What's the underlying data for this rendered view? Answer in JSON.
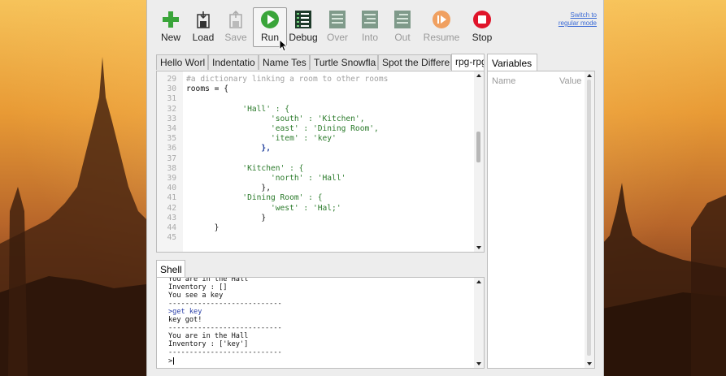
{
  "toolbar": {
    "buttons": [
      {
        "id": "new",
        "label": "New",
        "icon": "plus-icon",
        "enabled": true
      },
      {
        "id": "load",
        "label": "Load",
        "icon": "load-icon",
        "enabled": true
      },
      {
        "id": "save",
        "label": "Save",
        "icon": "save-icon",
        "enabled": false
      },
      {
        "id": "run",
        "label": "Run",
        "icon": "run-icon",
        "enabled": true
      },
      {
        "id": "debug",
        "label": "Debug",
        "icon": "debug-icon",
        "enabled": true
      },
      {
        "id": "over",
        "label": "Over",
        "icon": "step-over-icon",
        "enabled": false
      },
      {
        "id": "into",
        "label": "Into",
        "icon": "step-into-icon",
        "enabled": false
      },
      {
        "id": "out",
        "label": "Out",
        "icon": "step-out-icon",
        "enabled": false
      },
      {
        "id": "resume",
        "label": "Resume",
        "icon": "resume-icon",
        "enabled": false
      },
      {
        "id": "stop",
        "label": "Stop",
        "icon": "stop-icon",
        "enabled": true
      }
    ],
    "mode_link_line1": "Switch to",
    "mode_link_line2": "regular mode"
  },
  "editor": {
    "tabs": [
      "Hello Worl",
      "Indentatio",
      "Name Tes",
      "Turtle Snowfla",
      "Spot the Differe",
      "rpg-rpg."
    ],
    "active_tab": 5,
    "lines": [
      {
        "n": "29",
        "code": "#a dictionary linking a room to other rooms",
        "kind": "comment"
      },
      {
        "n": "30",
        "code": "rooms = {",
        "kind": "plain"
      },
      {
        "n": "31",
        "code": "",
        "kind": "plain"
      },
      {
        "n": "32",
        "code": "            'Hall' : {",
        "kind": "str"
      },
      {
        "n": "33",
        "code": "                  'south' : 'Kitchen',",
        "kind": "str"
      },
      {
        "n": "34",
        "code": "                  'east' : 'Dining Room',",
        "kind": "str"
      },
      {
        "n": "35",
        "code": "                  'item' : 'key'",
        "kind": "str"
      },
      {
        "n": "36",
        "code": "                },",
        "kind": "brace"
      },
      {
        "n": "37",
        "code": "",
        "kind": "plain"
      },
      {
        "n": "38",
        "code": "            'Kitchen' : {",
        "kind": "str"
      },
      {
        "n": "39",
        "code": "                  'north' : 'Hall'",
        "kind": "str"
      },
      {
        "n": "40",
        "code": "                },",
        "kind": "plain"
      },
      {
        "n": "41",
        "code": "            'Dining Room' : {",
        "kind": "str"
      },
      {
        "n": "42",
        "code": "                  'west' : 'Hal;'",
        "kind": "str"
      },
      {
        "n": "43",
        "code": "                }",
        "kind": "plain"
      },
      {
        "n": "44",
        "code": "      }",
        "kind": "plain"
      },
      {
        "n": "45",
        "code": "",
        "kind": "plain"
      }
    ]
  },
  "variables": {
    "tab": "Variables",
    "col_name": "Name",
    "col_value": "Value"
  },
  "shell": {
    "tab": "Shell",
    "lines": [
      {
        "text": "You are in the Hall",
        "kind": "out"
      },
      {
        "text": "Inventory : []",
        "kind": "out"
      },
      {
        "text": "You see a key",
        "kind": "out"
      },
      {
        "text": "---------------------------",
        "kind": "out"
      },
      {
        "text": ">get key",
        "kind": "input"
      },
      {
        "text": "key got!",
        "kind": "out"
      },
      {
        "text": "---------------------------",
        "kind": "out"
      },
      {
        "text": "You are in the Hall",
        "kind": "out"
      },
      {
        "text": "Inventory : ['key']",
        "kind": "out"
      },
      {
        "text": "---------------------------",
        "kind": "out"
      }
    ],
    "prompt": ">"
  },
  "colors": {
    "accent_green": "#3aa53a",
    "stop_red": "#e0142a",
    "resume_orange": "#f0a060",
    "link_blue": "#3a6ad6",
    "string_green": "#2a7a2a"
  }
}
